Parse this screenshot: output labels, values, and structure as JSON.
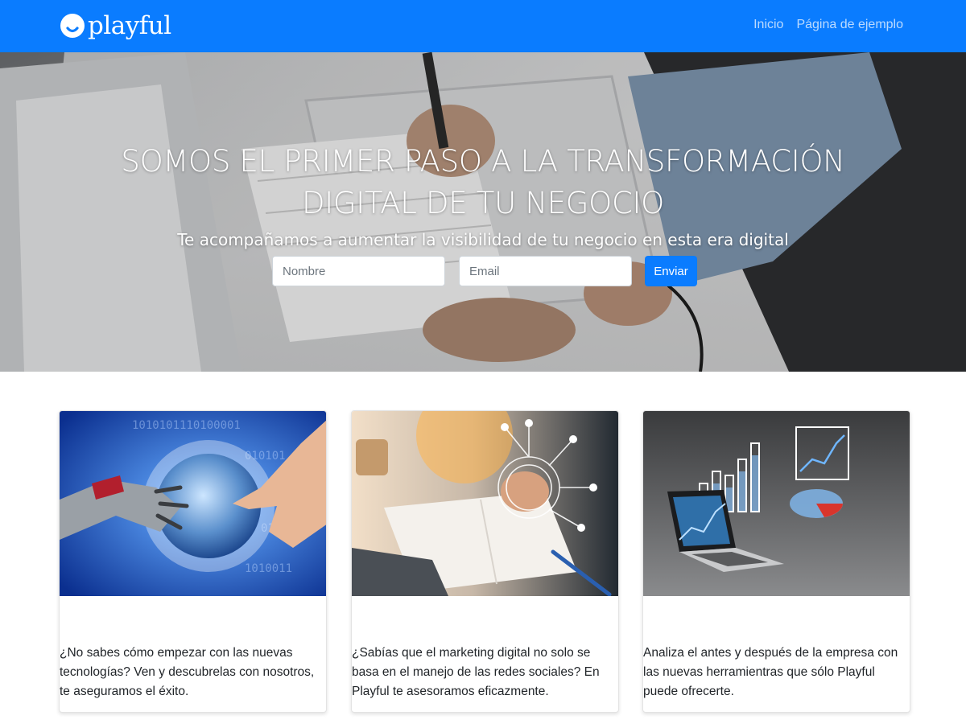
{
  "brand": {
    "name": "playful"
  },
  "nav": {
    "links": [
      "Inicio",
      "Página de ejemplo"
    ]
  },
  "hero": {
    "title": "SOMOS EL PRIMER PASO A LA TRANSFORMACIÓN DIGITAL DE TU NEGOCIO",
    "subtitle": "Te acompañamos a aumentar la visibilidad de tu negocio en esta era digital",
    "form": {
      "name_placeholder": "Nombre",
      "email_placeholder": "Email",
      "submit_label": "Enviar"
    }
  },
  "cards": [
    {
      "text": "¿No sabes cómo empezar con las nuevas tecnologías? Ven y descubrelas con nosotros, te aseguramos el éxito.",
      "image": "robot-human-hand-image"
    },
    {
      "text": "¿Sabías que el marketing digital no solo se basa en el manejo de las redes sociales? En Playful te asesoramos eficazmente.",
      "image": "digital-marketing-desk-image"
    },
    {
      "text": "Analiza el antes y después de la empresa con las nuevas herramientras que sólo Playful puede ofrecerte.",
      "image": "laptop-charts-image"
    }
  ],
  "colors": {
    "primary": "#0a7cff",
    "nav_link": "#cfe3ff",
    "text": "#212529"
  }
}
